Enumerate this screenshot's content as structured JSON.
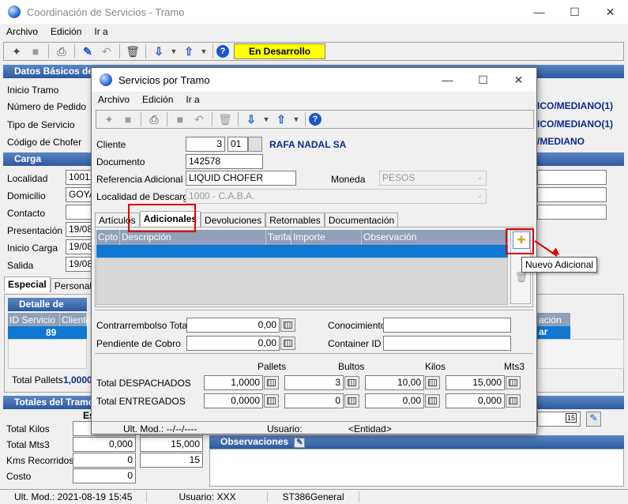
{
  "main_window": {
    "title": "Coordinación de Servicios - Tramo",
    "menu": [
      "Archivo",
      "Edición",
      "Ir a"
    ],
    "status_label": "En Desarrollo",
    "datos_basicos": {
      "header": "Datos Básicos del",
      "labels": [
        "Inicio Tramo",
        "Número de Pedido",
        "Tipo de Servicio",
        "Código de Chofer"
      ],
      "right_values": [
        "ICO/MEDIANO(1)",
        "ICO/MEDIANO(1)",
        "/MEDIANO"
      ]
    },
    "carga": {
      "header": "Carga",
      "labels": [
        "Localidad",
        "Domicilio",
        "Contacto",
        "Presentación",
        "Inicio Carga",
        "Salida"
      ],
      "values": [
        "10012",
        "GOYA",
        "",
        "19/08",
        "19/08",
        "19/08"
      ]
    },
    "tabs": [
      "Especial",
      "Personal"
    ],
    "detalle": {
      "header": "Detalle de Servic",
      "cols": [
        "ID Servicio",
        "Cliente"
      ],
      "row_id": "89",
      "row_client": "6",
      "right_col": "ación",
      "right_val": "ar"
    },
    "total_pallets_label": "Total Pallets",
    "total_pallets_value": "1,0000",
    "totales": {
      "header": "Totales del Tramo",
      "sub": "Es",
      "labels": [
        "Total Kilos",
        "Total Mts3",
        "Kms Recorridos",
        "Costo"
      ],
      "col1": [
        "",
        "0,000",
        "0",
        "0"
      ],
      "col2": [
        "",
        "15,000",
        "15",
        ""
      ]
    },
    "observaciones_header": "Observaciones",
    "date_field": "15",
    "statusbar": {
      "ult_mod": "Ult. Mod.: 2021-08-19 15:45",
      "usuario": "Usuario: XXX",
      "code": "ST386General"
    }
  },
  "dialog": {
    "title": "Servicios por Tramo",
    "menu": [
      "Archivo",
      "Edición",
      "Ir a"
    ],
    "cliente_label": "Cliente",
    "cliente_code": "3",
    "cliente_suffix": "01",
    "cliente_name": "RAFA NADAL SA",
    "documento_label": "Documento",
    "documento_value": "142578",
    "ref_label": "Referencia Adicional",
    "ref_value": "LIQUID CHOFER",
    "moneda_label": "Moneda",
    "moneda_value": "PESOS",
    "localidad_label": "Localidad de Descarga",
    "localidad_value": "1000 - C.A.B.A.",
    "tabs": [
      "Artículos",
      "Adicionales",
      "Devoluciones",
      "Retornables",
      "Documentación"
    ],
    "grid_cols": [
      "Cpto",
      "Descripción",
      "Tarifa",
      "Importe",
      "Observación"
    ],
    "contrarrembolso_label": "Contrarrembolso Total",
    "contrarrembolso_value": "0,00",
    "pendiente_label": "Pendiente de Cobro",
    "pendiente_value": "0,00",
    "conocimiento_label": "Conocimiento",
    "container_label": "Container ID",
    "cols": [
      "Pallets",
      "Bultos",
      "Kilos",
      "Mts3"
    ],
    "despachados_label": "Total DESPACHADOS",
    "despachados": [
      "1,0000",
      "3",
      "10,00",
      "15,000"
    ],
    "entregados_label": "Total ENTREGADOS",
    "entregados": [
      "0,0000",
      "0",
      "0,00",
      "0,000"
    ],
    "footer_ult_mod": "Ult. Mod.: --/--/----",
    "footer_usuario": "Usuario:",
    "footer_entidad": "<Entidad>",
    "tooltip": "Nuevo Adicional"
  },
  "colors": {
    "accent_blue": "#2c5aa0",
    "status_yellow": "#ffff00",
    "highlight_red": "#e00000",
    "grid_select": "#0e78d4"
  }
}
